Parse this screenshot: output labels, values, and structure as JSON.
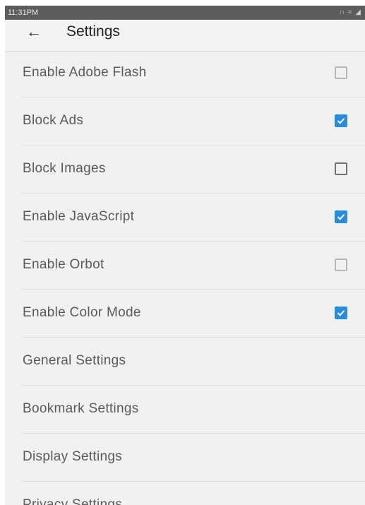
{
  "status_bar": {
    "time": "11:31PM",
    "icons": [
      "headphone-icon",
      "wifi-icon",
      "signal-icon"
    ]
  },
  "toolbar": {
    "back_icon": "arrow-left-icon",
    "title": "Settings"
  },
  "settings": [
    {
      "label": "Enable Adobe Flash",
      "has_checkbox": true,
      "checked": false
    },
    {
      "label": "Block Ads",
      "has_checkbox": true,
      "checked": true
    },
    {
      "label": "Block Images",
      "has_checkbox": true,
      "checked": false
    },
    {
      "label": "Enable JavaScript",
      "has_checkbox": true,
      "checked": true
    },
    {
      "label": "Enable Orbot",
      "has_checkbox": true,
      "checked": false
    },
    {
      "label": "Enable Color Mode",
      "has_checkbox": true,
      "checked": true
    },
    {
      "label": "General Settings",
      "has_checkbox": false
    },
    {
      "label": "Bookmark Settings",
      "has_checkbox": false
    },
    {
      "label": "Display Settings",
      "has_checkbox": false
    },
    {
      "label": "Privacy Settings",
      "has_checkbox": false
    }
  ],
  "colors": {
    "accent": "#2a8bd8",
    "background": "#f1f1f1",
    "status_bar": "#5c5c5c"
  }
}
